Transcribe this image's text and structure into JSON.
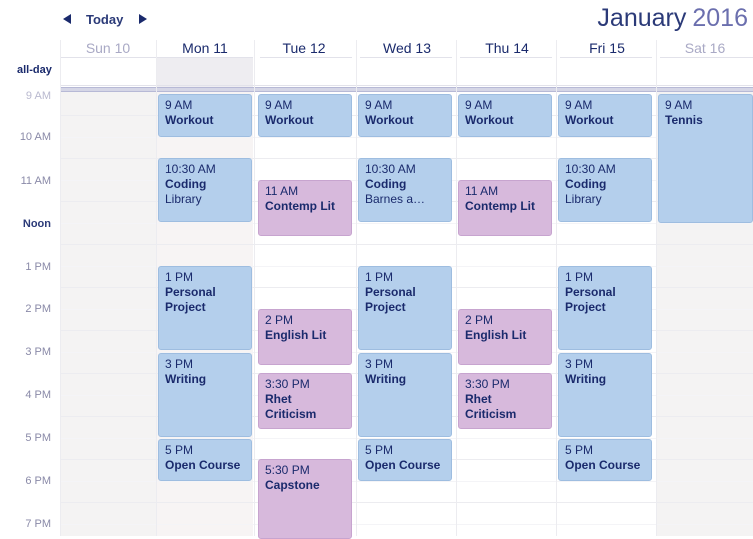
{
  "toolbar": {
    "today_label": "Today",
    "title_month": "January",
    "title_year": "2016"
  },
  "days": [
    {
      "label": "Sun 10"
    },
    {
      "label": "Mon 11"
    },
    {
      "label": "Tue 12"
    },
    {
      "label": "Wed 13"
    },
    {
      "label": "Thu 14"
    },
    {
      "label": "Fri 15"
    },
    {
      "label": "Sat 16"
    }
  ],
  "allday_label": "all-day",
  "times": [
    "9 AM",
    "10 AM",
    "11 AM",
    "Noon",
    "1 PM",
    "2 PM",
    "3 PM",
    "4 PM",
    "5 PM",
    "6 PM",
    "7 PM"
  ],
  "events": {
    "mon": [
      {
        "time": "9 AM",
        "name": "Workout",
        "location": ""
      },
      {
        "time": "10:30 AM",
        "name": "Coding",
        "location": "Library"
      },
      {
        "time": "1 PM",
        "name": "Personal Project",
        "location": ""
      },
      {
        "time": "3 PM",
        "name": "Writing",
        "location": ""
      },
      {
        "time": "5 PM",
        "name": "Open Course",
        "location": ""
      }
    ],
    "tue": [
      {
        "time": "9 AM",
        "name": "Workout",
        "location": ""
      },
      {
        "time": "11 AM",
        "name": "Contemp Lit",
        "location": ""
      },
      {
        "time": "2 PM",
        "name": "English Lit",
        "location": ""
      },
      {
        "time": "3:30 PM",
        "name": "Rhet Criticism",
        "location": ""
      },
      {
        "time": "5:30 PM",
        "name": "Capstone",
        "location": ""
      }
    ],
    "wed": [
      {
        "time": "9 AM",
        "name": "Workout",
        "location": ""
      },
      {
        "time": "10:30 AM",
        "name": "Coding",
        "location": "Barnes a…"
      },
      {
        "time": "1 PM",
        "name": "Personal Project",
        "location": ""
      },
      {
        "time": "3 PM",
        "name": "Writing",
        "location": ""
      },
      {
        "time": "5 PM",
        "name": "Open Course",
        "location": ""
      }
    ],
    "thu": [
      {
        "time": "9 AM",
        "name": "Workout",
        "location": ""
      },
      {
        "time": "11 AM",
        "name": "Contemp Lit",
        "location": ""
      },
      {
        "time": "2 PM",
        "name": "English Lit",
        "location": ""
      },
      {
        "time": "3:30 PM",
        "name": "Rhet Criticism",
        "location": ""
      }
    ],
    "fri": [
      {
        "time": "9 AM",
        "name": "Workout",
        "location": ""
      },
      {
        "time": "10:30 AM",
        "name": "Coding",
        "location": "Library"
      },
      {
        "time": "1 PM",
        "name": "Personal Project",
        "location": ""
      },
      {
        "time": "3 PM",
        "name": "Writing",
        "location": ""
      },
      {
        "time": "5 PM",
        "name": "Open Course",
        "location": ""
      }
    ],
    "sat": [
      {
        "time": "9 AM",
        "name": "Tennis",
        "location": ""
      }
    ]
  },
  "colors": {
    "event_blue": "#b4cfec",
    "event_purple": "#d7b9dc",
    "header_text": "#1a2a6c",
    "weekend_text": "#a9a9c5"
  }
}
